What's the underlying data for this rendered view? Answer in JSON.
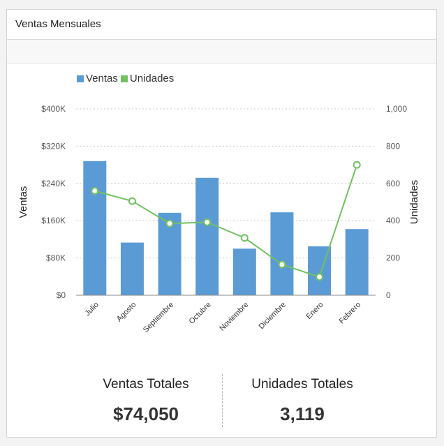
{
  "panel": {
    "title": "Ventas Mensuales"
  },
  "colors": {
    "bar": "#5b9bd5",
    "line": "#70c15f",
    "grid": "#c8c8c8",
    "axis": "#888888"
  },
  "summary": {
    "ventas_label": "Ventas Totales",
    "ventas_value": "$74,050",
    "unidades_label": "Unidades Totales",
    "unidades_value": "3,119"
  },
  "chart_data": {
    "type": "bar",
    "categories": [
      "Julio",
      "Agosto",
      "Septiembre",
      "Octubre",
      "Noviembre",
      "Diciembre",
      "Enero",
      "Febrero"
    ],
    "series": [
      {
        "name": "Ventas",
        "type": "bar",
        "axis": "left",
        "values": [
          288000,
          113000,
          177000,
          252000,
          100000,
          178000,
          105000,
          142000
        ]
      },
      {
        "name": "Unidades",
        "type": "line",
        "axis": "right",
        "values": [
          560,
          505,
          385,
          392,
          308,
          165,
          98,
          700
        ]
      }
    ],
    "ylabel": "Ventas",
    "y2label": "Unidades",
    "ylim": [
      0,
      400000
    ],
    "y2lim": [
      0,
      1000
    ],
    "yticks": [
      "$0",
      "$80K",
      "$160K",
      "$240K",
      "$320K",
      "$400K"
    ],
    "y2ticks": [
      "0",
      "200",
      "400",
      "600",
      "800",
      "1,000"
    ],
    "grid": true,
    "legend": "top-left"
  }
}
